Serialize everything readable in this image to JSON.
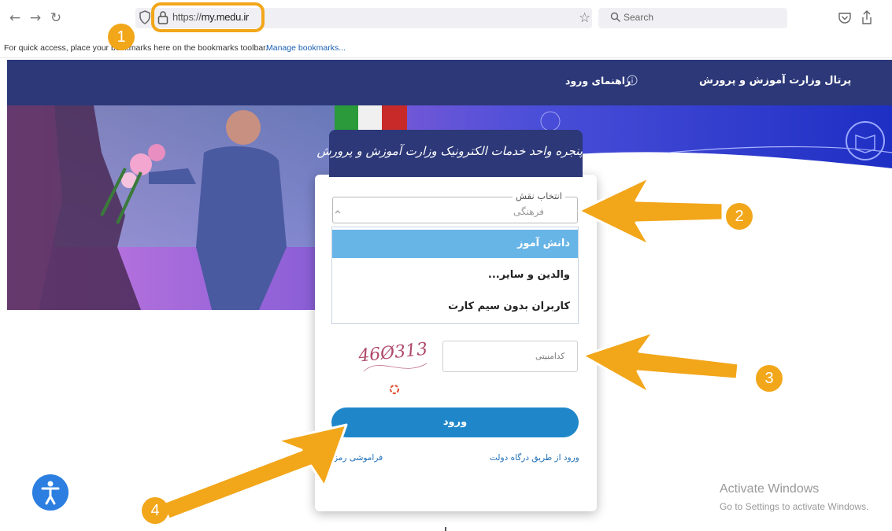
{
  "browser": {
    "url_prefix": "https://",
    "url_host": "my.medu.ir",
    "search_placeholder": "Search",
    "bookmarks_bar_text": "For quick access, place your bookmarks here on the bookmarks toolbar.",
    "bookmarks_manage_link": "Manage bookmarks...",
    "icons": [
      "back-icon",
      "forward-icon",
      "reload-icon",
      "shield-icon",
      "lock-icon",
      "star-icon",
      "search-icon",
      "pocket-icon",
      "share-icon"
    ]
  },
  "header": {
    "portal_title": "پرتال وزارت آموزش و پرورش",
    "login_guide": "راهنمای ورود",
    "background_color": "#2c3878"
  },
  "login_card": {
    "title": "پنجره واحد خدمات الکترونیک وزارت آموزش و پرورش",
    "role_legend": "انتخاب نقش",
    "role_selected_value": "فرهنگی",
    "role_options": [
      {
        "label": "دانش آموز",
        "highlighted": true
      },
      {
        "label": "والدین و سایر...",
        "highlighted": false
      },
      {
        "label": "کاربران بدون سیم کارت",
        "highlighted": false
      }
    ],
    "captcha_placeholder": "کدامنیتی",
    "captcha_text": "46Ø313",
    "login_button": "ورود",
    "gov_gateway_link": "ورود از طریق درگاه دولت",
    "forgot_password_link": "فراموشی رمز",
    "button_color": "#1f87c9",
    "highlight_color": "#67b4e6"
  },
  "watermark": {
    "line1": "Activate Windows",
    "line2": "Go to Settings to activate Windows."
  },
  "annotations": {
    "color": "#f2a61a",
    "badges": [
      "1",
      "2",
      "3",
      "4"
    ]
  }
}
